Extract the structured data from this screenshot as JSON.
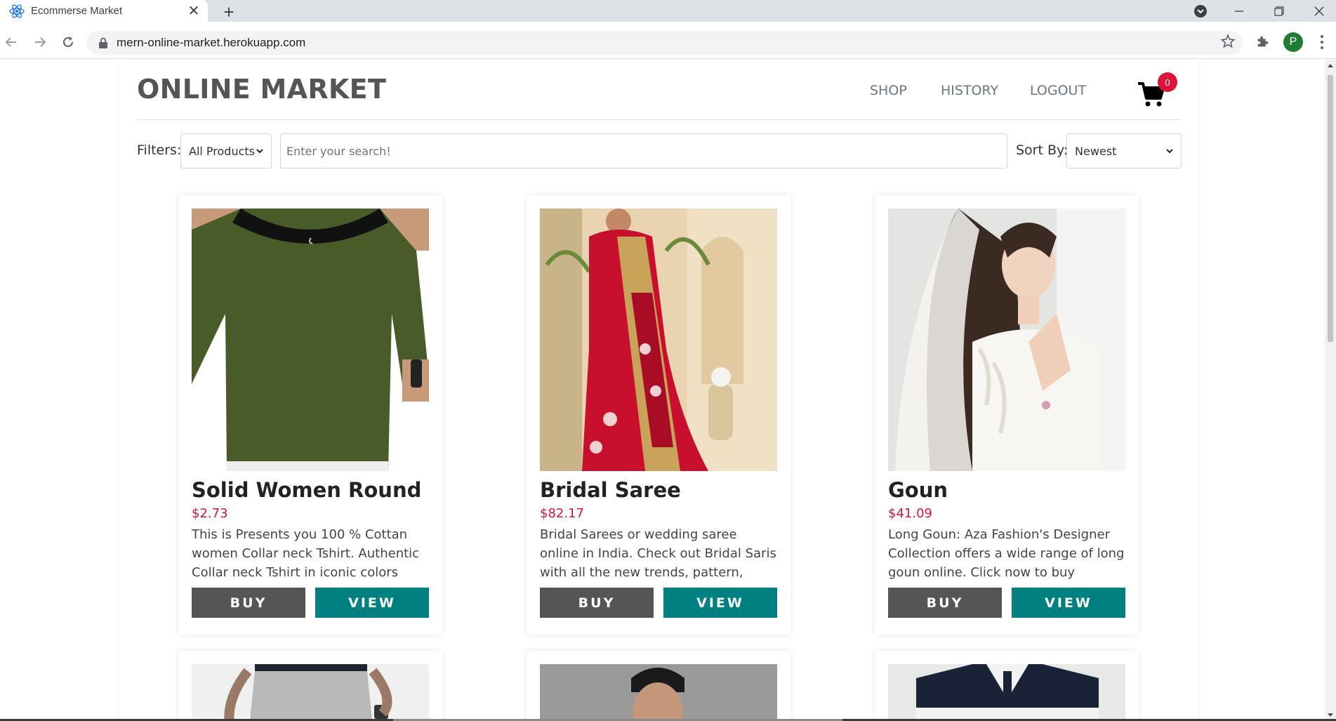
{
  "browser": {
    "tab_title": "Ecommerse Market",
    "url": "mern-online-market.herokuapp.com",
    "profile_initial": "P"
  },
  "header": {
    "brand": "ONLINE MARKET",
    "nav": [
      "SHOP",
      "HISTORY",
      "LOGOUT"
    ],
    "cart_count": "0"
  },
  "filters": {
    "filters_label": "Filters:",
    "category_value": "All Products",
    "search_placeholder": "Enter your search!",
    "sort_label": "Sort By:",
    "sort_value": "Newest"
  },
  "products": [
    {
      "title": "Solid Women Round ...",
      "price": "$2.73",
      "description": "This is Presents you 100 % Cottan women Collar neck Tshirt. Authentic Collar neck Tshirt in iconic colors an...",
      "buy_label": "BUY",
      "view_label": "VIEW"
    },
    {
      "title": "Bridal Saree",
      "price": "$82.17",
      "description": "Bridal Sarees or wedding saree online in India. Check out Bridal Saris with all the new trends, pattern, design, colo...",
      "buy_label": "BUY",
      "view_label": "VIEW"
    },
    {
      "title": "Goun",
      "price": "$41.09",
      "description": "Long Goun: Aza Fashion's Designer Collection offers a wide range of long goun online. Click now to buy latest...",
      "buy_label": "BUY",
      "view_label": "VIEW"
    }
  ],
  "colors": {
    "brand_text": "#555555",
    "price": "#dc143c",
    "buy_button": "#555555",
    "view_button": "#008080",
    "cart_badge": "#dc143c"
  }
}
